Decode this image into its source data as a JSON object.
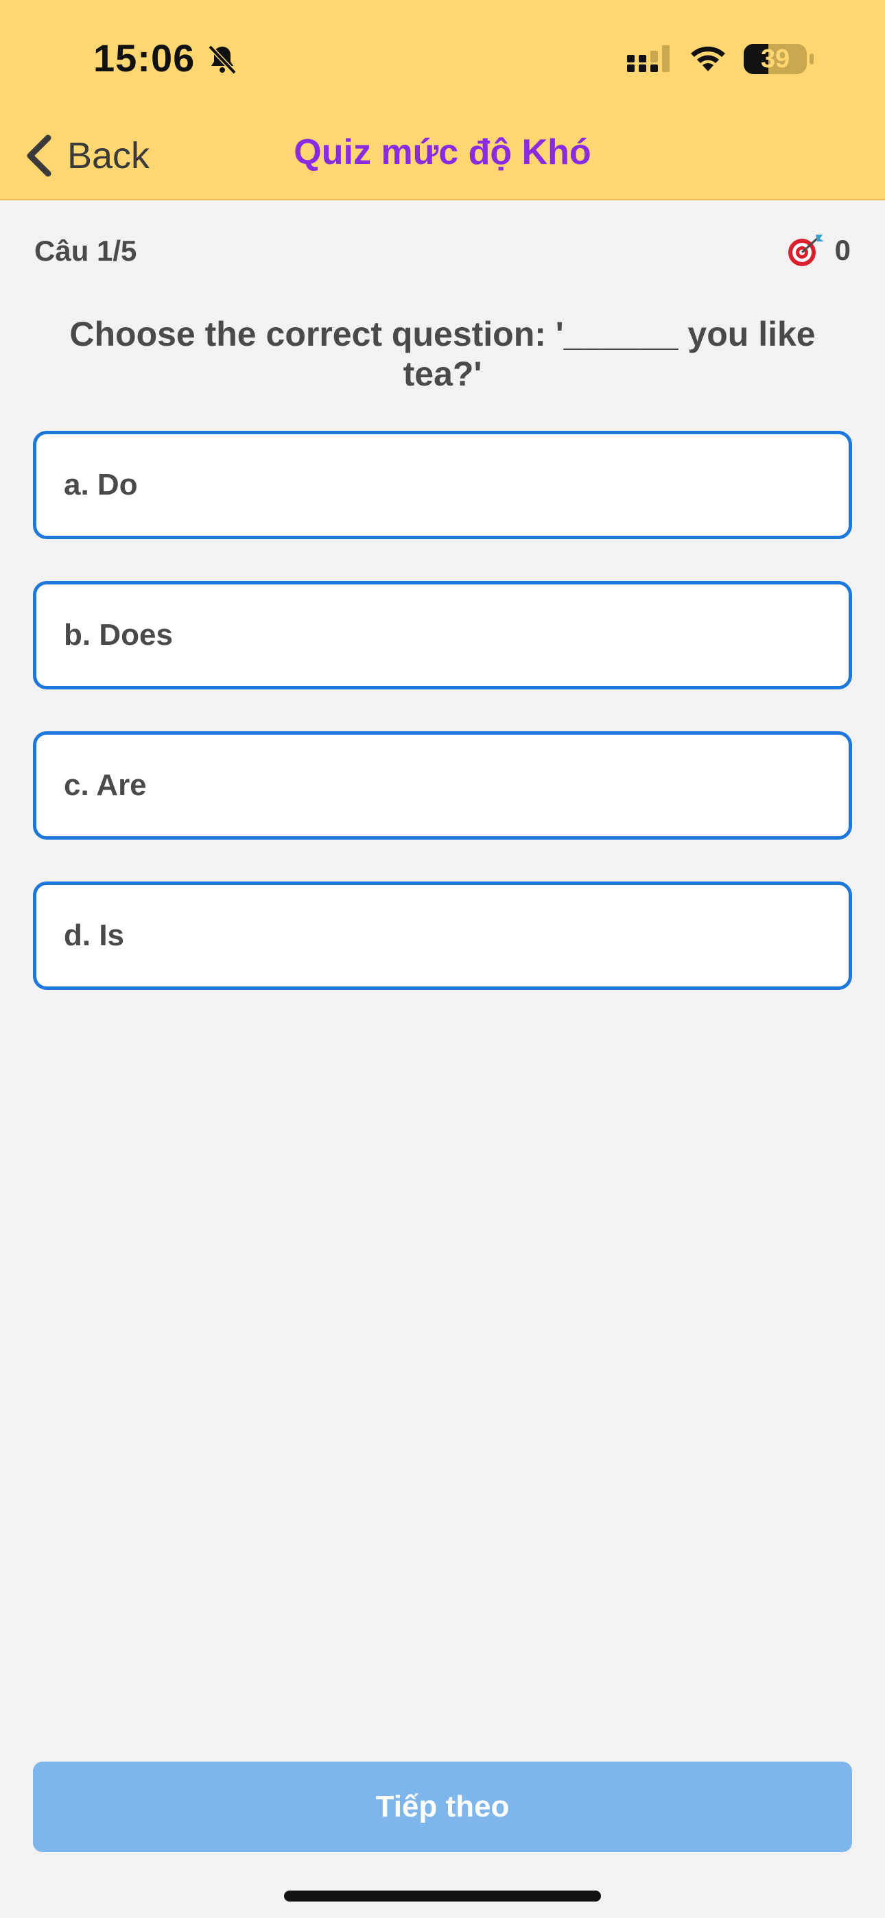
{
  "status_bar": {
    "time": "15:06",
    "battery": "39"
  },
  "nav": {
    "back_label": "Back",
    "title": "Quiz mức độ Khó"
  },
  "quiz": {
    "counter": "Câu 1/5",
    "score": "0",
    "question": "Choose the correct question: '______ you like tea?'",
    "options": [
      {
        "label": "a. Do"
      },
      {
        "label": "b. Does"
      },
      {
        "label": "c. Are"
      },
      {
        "label": "d. Is"
      }
    ],
    "next_label": "Tiếp theo"
  },
  "colors": {
    "header_bg": "#fed672",
    "title": "#8a2be2",
    "option_border": "#1e78dc",
    "next_button": "#7eb6ec"
  },
  "icons": [
    "bell-slash-icon",
    "signal-icon",
    "wifi-icon",
    "battery-icon",
    "chevron-left-icon",
    "target-icon"
  ]
}
